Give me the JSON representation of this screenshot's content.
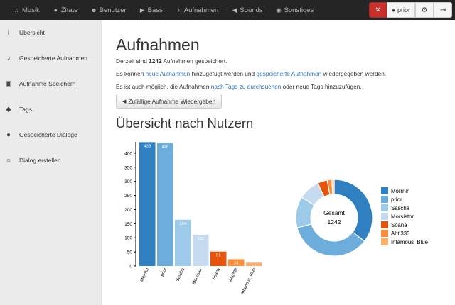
{
  "navbar": {
    "items": [
      {
        "icon": "music-icon",
        "glyph": "♫",
        "label": "Musik"
      },
      {
        "icon": "comment-icon",
        "glyph": "●",
        "label": "Zitate"
      },
      {
        "icon": "users-icon",
        "glyph": "☻",
        "label": "Benutzer"
      },
      {
        "icon": "play-circle-icon",
        "glyph": "▶",
        "label": "Bass"
      },
      {
        "icon": "microphone-icon",
        "glyph": "♪",
        "label": "Aufnahmen"
      },
      {
        "icon": "volume-icon",
        "glyph": "◀",
        "label": "Sounds"
      },
      {
        "icon": "dashboard-icon",
        "glyph": "◉",
        "label": "Sonstiges"
      }
    ],
    "user_label": "prior",
    "mute_color": "#c9302c"
  },
  "sidebar": {
    "items": [
      {
        "icon": "info-icon",
        "glyph": "i",
        "label": "Übersicht"
      },
      {
        "icon": "microphone-icon",
        "glyph": "♪",
        "label": "Gespeicherte Aufnahmen"
      },
      {
        "icon": "save-icon",
        "glyph": "▣",
        "label": "Aufnahme Speichern"
      },
      {
        "icon": "tags-icon",
        "glyph": "◆",
        "label": "Tags"
      },
      {
        "icon": "comments-icon",
        "glyph": "●",
        "label": "Gespeicherte Dialoge"
      },
      {
        "icon": "comment-icon",
        "glyph": "○",
        "label": "Dialog erstellen"
      }
    ]
  },
  "main": {
    "title": "Aufnahmen",
    "count_prefix": "Derzeit sind ",
    "count": "1242",
    "count_suffix": " Aufnahmen gespeichert.",
    "line2_prefix": "Es können ",
    "line2_link1": "neue Aufnahmen",
    "line2_mid": " hinzugefügt werden und ",
    "line2_link2": "gespeicherte Aufnahmen",
    "line2_suffix": " wiedergegeben werden.",
    "line3_prefix": "Es ist auch möglich, die Aufnahmen ",
    "line3_link": "nach Tags zu durchsuchen",
    "line3_suffix": " oder neue Tags hinzuzufügen.",
    "random_button": "Zufällige Aufnahme Wiedergeben",
    "section_title": "Übersicht nach Nutzern",
    "link_color": "#2a6fb5"
  },
  "chart_data": [
    {
      "type": "bar",
      "categories": [
        "Mörrrlin",
        "prior",
        "Sascha",
        "Morsistor",
        "Soana",
        "Ahti333",
        "Infamous_Blue"
      ],
      "values": [
        439,
        436,
        164,
        111,
        51,
        24,
        12
      ],
      "colors": [
        "#2f7fc1",
        "#6caddc",
        "#9ecae9",
        "#c6dbef",
        "#e6550d",
        "#fd8d3c",
        "#fdae6b"
      ],
      "ylim": [
        0,
        440
      ],
      "yticks": [
        0,
        50,
        100,
        150,
        200,
        250,
        300,
        350,
        400
      ],
      "title": "",
      "xlabel": "",
      "ylabel": ""
    },
    {
      "type": "pie",
      "center_label": "Gesamt",
      "center_value": "1242",
      "labels": [
        "Mörrrlin",
        "prior",
        "Sascha",
        "Morsistor",
        "Soana",
        "Ahti333",
        "Infamous_Blue"
      ],
      "values": [
        439,
        436,
        164,
        111,
        51,
        24,
        12
      ],
      "colors": [
        "#2f7fc1",
        "#6caddc",
        "#9ecae9",
        "#c6dbef",
        "#e6550d",
        "#fd8d3c",
        "#fdae6b"
      ],
      "legend": "right"
    }
  ]
}
